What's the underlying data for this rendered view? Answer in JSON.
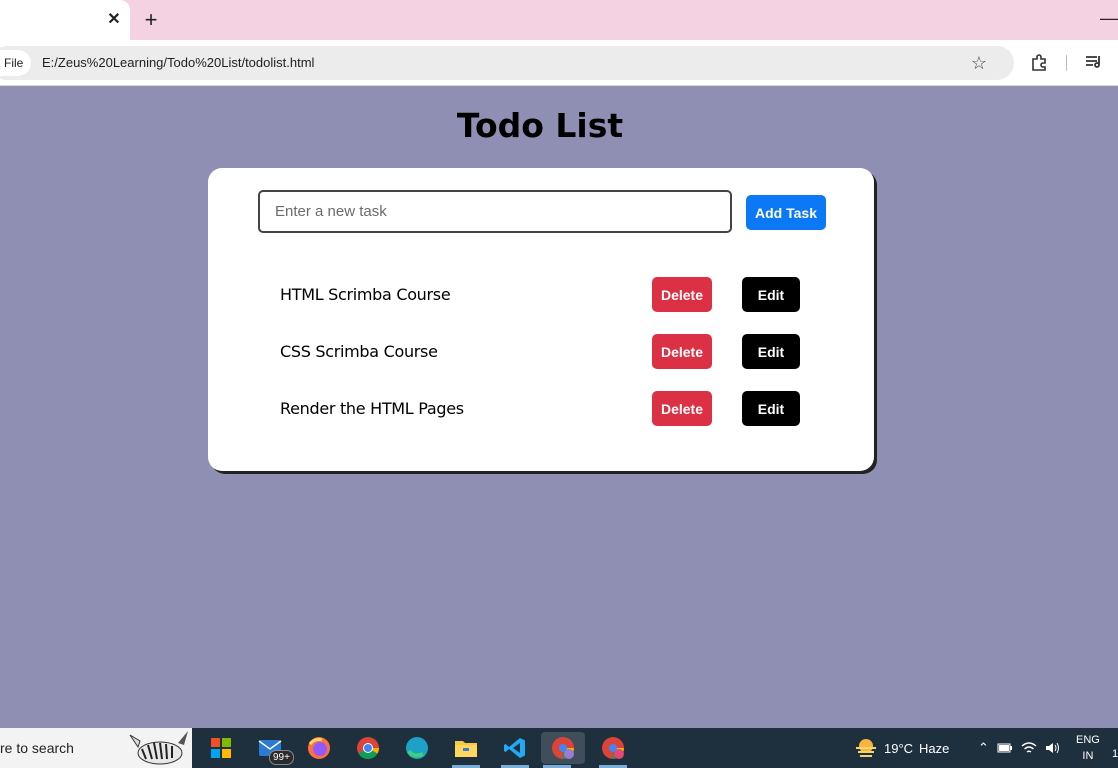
{
  "browser": {
    "tab_close": "✕",
    "new_tab": "+",
    "window_minimize": "—",
    "file_chip": "File",
    "url": "E:/Zeus%20Learning/Todo%20List/todolist.html"
  },
  "page": {
    "title": "Todo List",
    "input_placeholder": "Enter a new task",
    "add_label": "Add Task",
    "tasks": [
      {
        "text": "HTML Scrimba Course",
        "delete_label": "Delete",
        "edit_label": "Edit"
      },
      {
        "text": "CSS Scrimba Course",
        "delete_label": "Delete",
        "edit_label": "Edit"
      },
      {
        "text": "Render the HTML Pages",
        "delete_label": "Delete",
        "edit_label": "Edit"
      }
    ]
  },
  "colors": {
    "page_bg": "#8f8fb3",
    "add_button": "#0b78f5",
    "delete_button": "#dc3145",
    "edit_button": "#000000",
    "tab_strip": "#f5d2e2",
    "taskbar": "#1e2f3e"
  },
  "taskbar": {
    "search_text": "re to search",
    "mail_badge": "99+",
    "weather_temp": "19°C",
    "weather_desc": "Haze",
    "lang_line1": "ENG",
    "lang_line2": "IN",
    "clock_edge": "1",
    "apps": [
      "windows-icon",
      "mail-icon",
      "firefox-icon",
      "chrome-icon",
      "edge-icon",
      "file-explorer-icon",
      "vscode-icon",
      "chrome-profile-icon",
      "chrome-profile-k-icon"
    ]
  }
}
